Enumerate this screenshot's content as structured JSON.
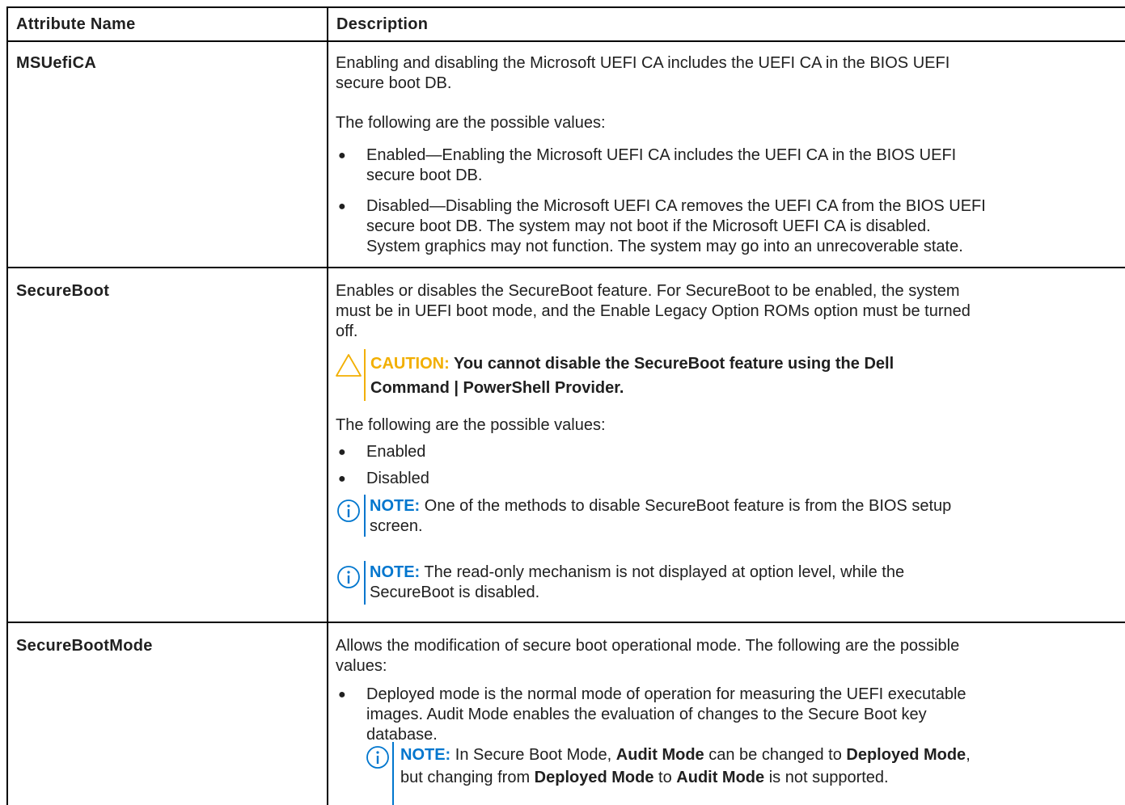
{
  "table": {
    "headers": {
      "attribute": "Attribute Name",
      "description": "Description"
    },
    "rows": [
      {
        "attribute": "MSUefiCA",
        "desc_p1_l1": "Enabling and disabling the Microsoft UEFI CA includes the UEFI CA in the BIOS UEFI",
        "desc_p1_l2": "secure boot DB.",
        "possible_values": "The following are the possible values:",
        "enabled_l1": "Enabled—Enabling the Microsoft UEFI CA includes the UEFI CA in the BIOS UEFI",
        "enabled_l2": "secure boot DB.",
        "disabled_l1": "Disabled—Disabling the Microsoft UEFI CA removes the UEFI CA from the BIOS UEFI",
        "disabled_l2": "secure boot DB. The system may not boot if the Microsoft UEFI CA is disabled.",
        "disabled_l3": "System graphics may not function. The system may go into an unrecoverable state."
      },
      {
        "attribute": "SecureBoot",
        "desc_l1": "Enables or disables the SecureBoot feature. For SecureBoot to be enabled, the system",
        "desc_l2": "must be in UEFI boot mode, and the Enable Legacy Option ROMs option must be turned",
        "desc_l3": "off.",
        "caution_label": "CAUTION:",
        "caution_l1": "You cannot disable the SecureBoot feature using the Dell",
        "caution_l2": "Command | PowerShell Provider.",
        "possible_values": "The following are the possible values:",
        "value1": "Enabled",
        "value2": "Disabled",
        "note1_label": "NOTE:",
        "note1_l1": "One of the methods to disable SecureBoot feature is from the BIOS setup",
        "note1_l2": "screen.",
        "note2_label": "NOTE:",
        "note2_l1": "The read-only mechanism is not displayed at option level, while the",
        "note2_l2": "SecureBoot is disabled."
      },
      {
        "attribute": "SecureBootMode",
        "desc_l1": "Allows the modification of secure boot operational mode. The following are the possible",
        "desc_l2": "values:",
        "bullet_l1": "Deployed mode is the normal mode of operation for measuring the UEFI executable",
        "bullet_l2": "images. Audit Mode enables the evaluation of changes to the Secure Boot key",
        "bullet_l3": "database.",
        "note_label": "NOTE:",
        "note_a": "In Secure Boot Mode,",
        "note_b": "Audit Mode",
        "note_c": "can be changed to",
        "note_d": "Deployed Mode",
        "note_e": ",",
        "note_f": "but changing from",
        "note_g": "Deployed Mode",
        "note_h": "to",
        "note_i": "Audit Mode",
        "note_j": "is not supported."
      }
    ]
  },
  "icons": {
    "caution": "caution-triangle-icon",
    "note": "info-circle-icon",
    "bullet": "●"
  },
  "colors": {
    "caution": "#f2af00",
    "note": "#0076ce",
    "border": "#000000",
    "text": "#202020"
  }
}
